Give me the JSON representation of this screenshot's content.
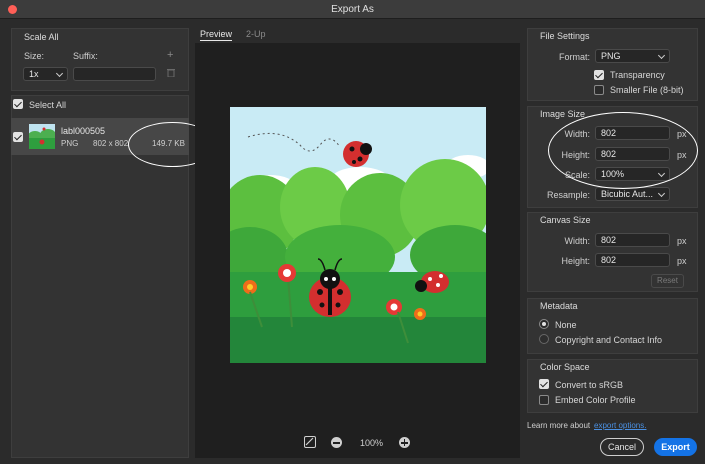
{
  "window": {
    "title": "Export As"
  },
  "left": {
    "scale_all_label": "Scale All",
    "size_label": "Size:",
    "suffix_label": "Suffix:",
    "size_value": "1x",
    "suffix_value": "",
    "add_symbol": "+",
    "delete_symbol": "🗑",
    "select_all_label": "Select All",
    "asset": {
      "name": "labl000505",
      "format": "PNG",
      "dimensions": "802 x 802",
      "filesize": "149.7 KB"
    }
  },
  "preview": {
    "tabs": [
      {
        "label": "Preview"
      },
      {
        "label": "2-Up"
      }
    ],
    "zoom": "100%"
  },
  "file_settings": {
    "title": "File Settings",
    "format_label": "Format:",
    "format_value": "PNG",
    "transparency_label": "Transparency",
    "transparency_checked": true,
    "smaller_file_label": "Smaller File (8-bit)",
    "smaller_file_checked": false
  },
  "image_size": {
    "title": "Image Size",
    "width_label": "Width:",
    "width_value": "802",
    "height_label": "Height:",
    "height_value": "802",
    "unit": "px",
    "scale_label": "Scale:",
    "scale_value": "100%",
    "resample_label": "Resample:",
    "resample_value": "Bicubic Aut..."
  },
  "canvas_size": {
    "title": "Canvas Size",
    "width_label": "Width:",
    "width_value": "802",
    "height_label": "Height:",
    "height_value": "802",
    "unit": "px",
    "reset_label": "Reset"
  },
  "metadata": {
    "title": "Metadata",
    "options": [
      {
        "label": "None",
        "selected": true
      },
      {
        "label": "Copyright and Contact Info",
        "selected": false
      }
    ]
  },
  "color_space": {
    "title": "Color Space",
    "convert_label": "Convert to sRGB",
    "convert_checked": true,
    "embed_label": "Embed Color Profile",
    "embed_checked": false
  },
  "footer": {
    "learn_more_text": "Learn more about",
    "learn_more_link": "export options.",
    "cancel_label": "Cancel",
    "export_label": "Export"
  },
  "colors": {
    "accent": "#1473e6",
    "link": "#4a90e2",
    "annotation": "#ffffff"
  }
}
